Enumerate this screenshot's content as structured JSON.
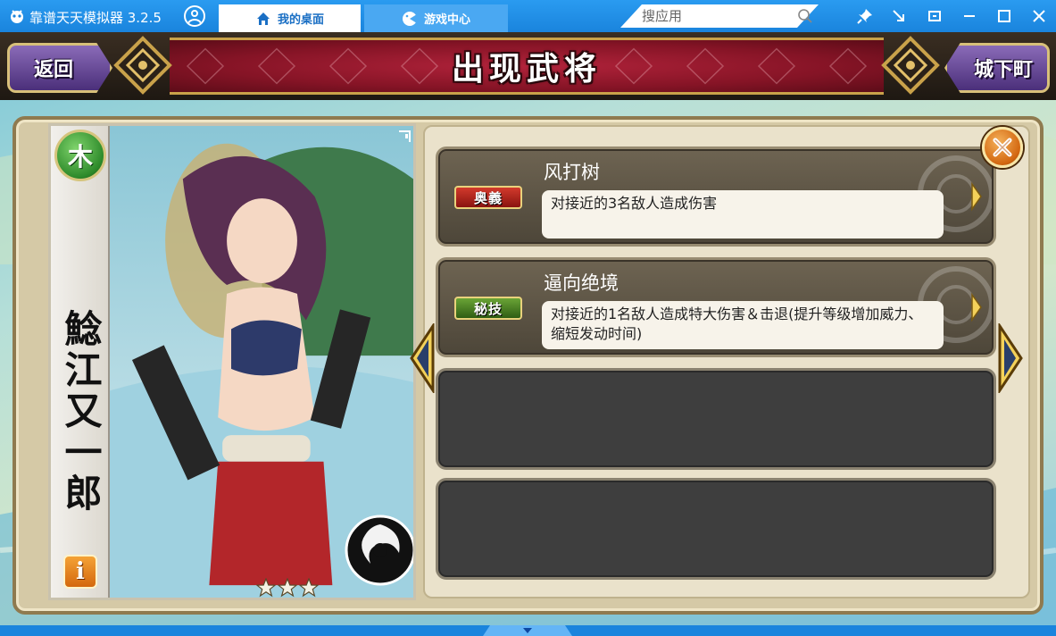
{
  "emulator": {
    "title": "靠谱天天模拟器 3.2.5",
    "tabs": [
      {
        "label": "我的桌面",
        "icon": "home-icon",
        "active": true
      },
      {
        "label": "游戏中心",
        "icon": "gamepad-icon",
        "active": false
      }
    ],
    "search": {
      "placeholder": "搜应用",
      "value": ""
    },
    "window_controls": [
      "pin-icon",
      "shrink-icon",
      "restore-icon",
      "minimize-icon",
      "maximize-icon",
      "close-icon"
    ],
    "accent_color": "#1a84dd"
  },
  "game": {
    "header": {
      "back_label": "返回",
      "title": "出现武将",
      "town_label": "城下町"
    },
    "card": {
      "element_glyph": "木",
      "name": "鯰江又一郎",
      "rarity_stars": 3,
      "info_label": "i"
    },
    "skills": [
      {
        "badge": "奥義",
        "badge_color": "#b8261c",
        "name": "风打树",
        "description": "对接近的3名敌人造成伤害"
      },
      {
        "badge": "秘技",
        "badge_color": "#4f8a24",
        "name": "逼向绝境",
        "description": "对接近的1名敌人造成特大伤害＆击退(提升等级增加威力、缩短发动时间)"
      }
    ],
    "empty_slots": 2
  }
}
